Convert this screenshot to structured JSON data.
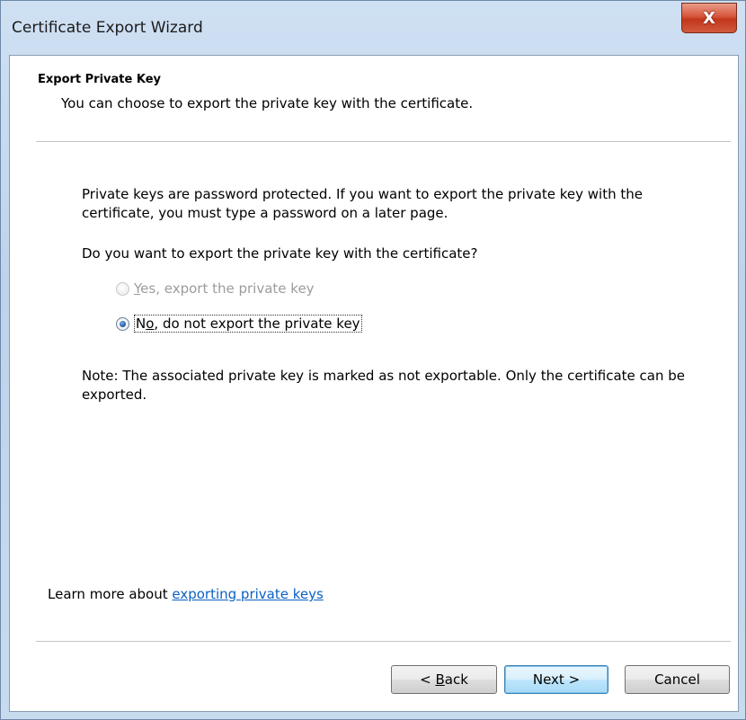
{
  "window": {
    "title": "Certificate Export Wizard",
    "close_label": "X"
  },
  "header": {
    "title": "Export Private Key",
    "subtitle": "You can choose to export the private key with the certificate."
  },
  "body": {
    "intro": "Private keys are password protected. If you want to export the private key with the certificate, you must type a password on a later page.",
    "question": "Do you want to export the private key with the certificate?",
    "options": [
      {
        "mnemonic": "Y",
        "rest": "es, export the private key",
        "enabled": false,
        "selected": false
      },
      {
        "mnemonic": "o",
        "prefix": "N",
        "rest": ", do not export the private key",
        "enabled": true,
        "selected": true
      }
    ],
    "note": "Note: The associated private key is marked as not exportable. Only the certificate can be exported."
  },
  "learn_more": {
    "prefix": "Learn more about ",
    "link": "exporting private keys"
  },
  "buttons": {
    "back_prefix": "< ",
    "back_mnemonic": "B",
    "back_rest": "ack",
    "next": "Next >",
    "cancel": "Cancel"
  },
  "colors": {
    "link": "#0b60c4",
    "close_button": "#c3361b",
    "default_button_border": "#3c7fb1"
  }
}
